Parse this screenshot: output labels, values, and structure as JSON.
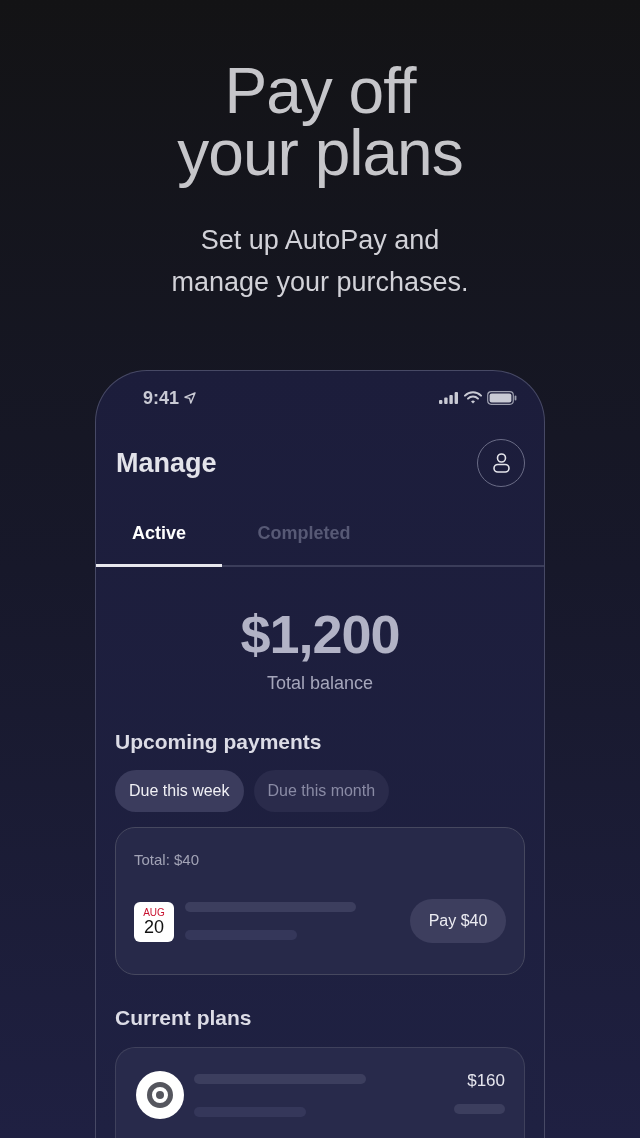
{
  "promo": {
    "headline": "Pay off your plans",
    "subtitle": "Set up AutoPay and manage your purchases."
  },
  "status_bar": {
    "time": "9:41"
  },
  "header": {
    "title": "Manage"
  },
  "tabs": [
    {
      "label": "Active",
      "selected": true
    },
    {
      "label": "Completed",
      "selected": false
    }
  ],
  "balance": {
    "amount": "$1,200",
    "label": "Total balance"
  },
  "upcoming_payments": {
    "title": "Upcoming payments",
    "filters": [
      {
        "label": "Due this week",
        "selected": true
      },
      {
        "label": "Due this month",
        "selected": false
      }
    ],
    "total": "Total: $40",
    "payments": [
      {
        "month": "AUG",
        "day": "20",
        "button": "Pay $40"
      }
    ]
  },
  "current_plans": {
    "title": "Current plans",
    "plans": [
      {
        "amount": "$160"
      }
    ]
  }
}
